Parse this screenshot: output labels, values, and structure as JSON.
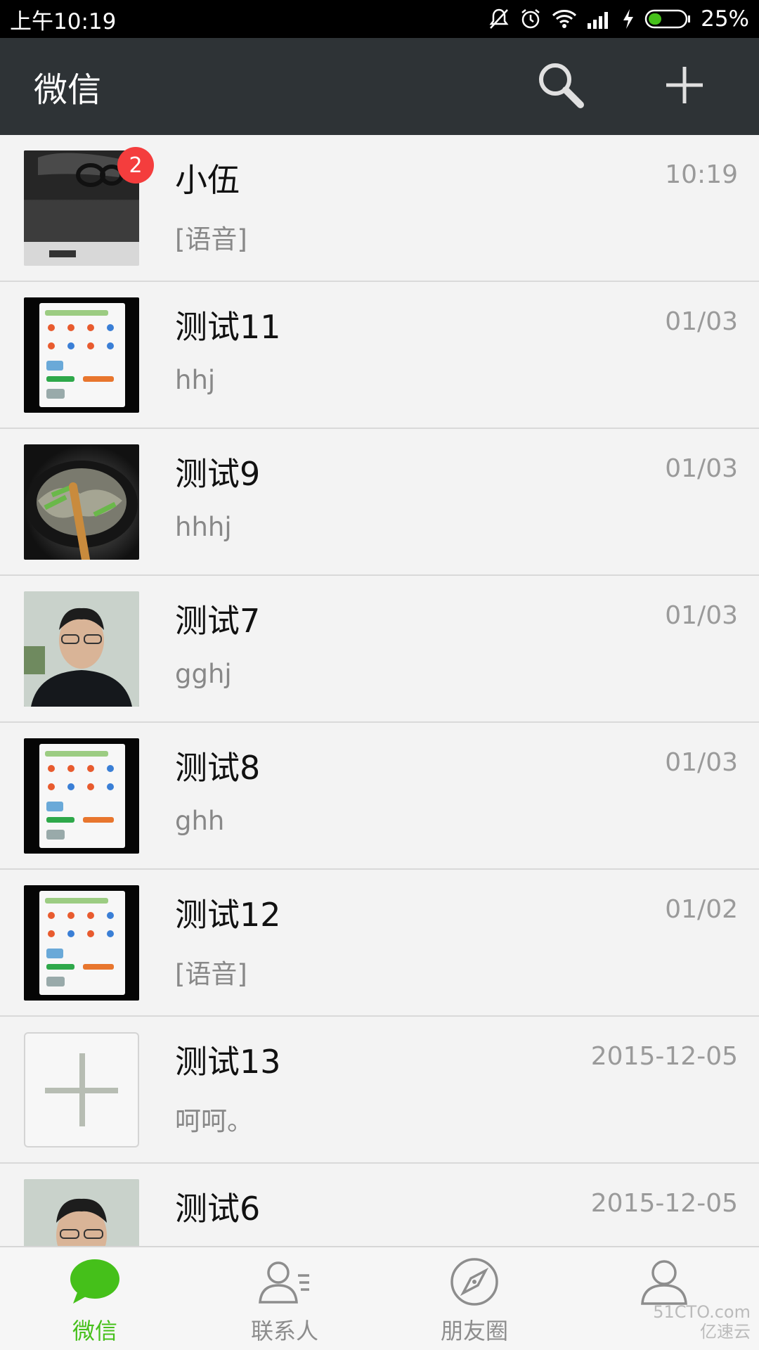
{
  "status_bar": {
    "time": "上午10:19",
    "battery_percent": "25%",
    "icons": [
      "mute-icon",
      "alarm-icon",
      "wifi-icon",
      "signal-icon",
      "charging-icon",
      "battery-icon"
    ]
  },
  "header": {
    "title": "微信",
    "search_icon": "search-icon",
    "add_icon": "plus-icon"
  },
  "chats": [
    {
      "name": "小伍",
      "preview": "[语音]",
      "time": "10:19",
      "badge": "2",
      "avatar": "desk-photo"
    },
    {
      "name": "测试11",
      "preview": "hhj",
      "time": "01/03",
      "avatar": "phone-screenshot"
    },
    {
      "name": "测试9",
      "preview": "hhhj",
      "time": "01/03",
      "avatar": "food-photo"
    },
    {
      "name": "测试7",
      "preview": "gghj",
      "time": "01/03",
      "avatar": "person-photo"
    },
    {
      "name": "测试8",
      "preview": "ghh",
      "time": "01/03",
      "avatar": "phone-screenshot"
    },
    {
      "name": "测试12",
      "preview": "[语音]",
      "time": "01/02",
      "avatar": "phone-screenshot"
    },
    {
      "name": "测试13",
      "preview": "呵呵。",
      "time": "2015-12-05",
      "avatar": "add-placeholder"
    },
    {
      "name": "测试6",
      "preview": "",
      "time": "2015-12-05",
      "avatar": "person-photo"
    }
  ],
  "tabs": [
    {
      "label": "微信",
      "icon": "chat-bubble-icon",
      "active": true
    },
    {
      "label": "联系人",
      "icon": "contacts-icon",
      "active": false
    },
    {
      "label": "朋友圈",
      "icon": "compass-icon",
      "active": false
    },
    {
      "label": "",
      "icon": "me-icon",
      "active": false
    }
  ],
  "watermark": {
    "line1": "51CTO.com",
    "line2": "亿速云"
  },
  "colors": {
    "header_bg": "#2e3336",
    "accent_green": "#45c01a",
    "badge_red": "#f43d3d"
  }
}
